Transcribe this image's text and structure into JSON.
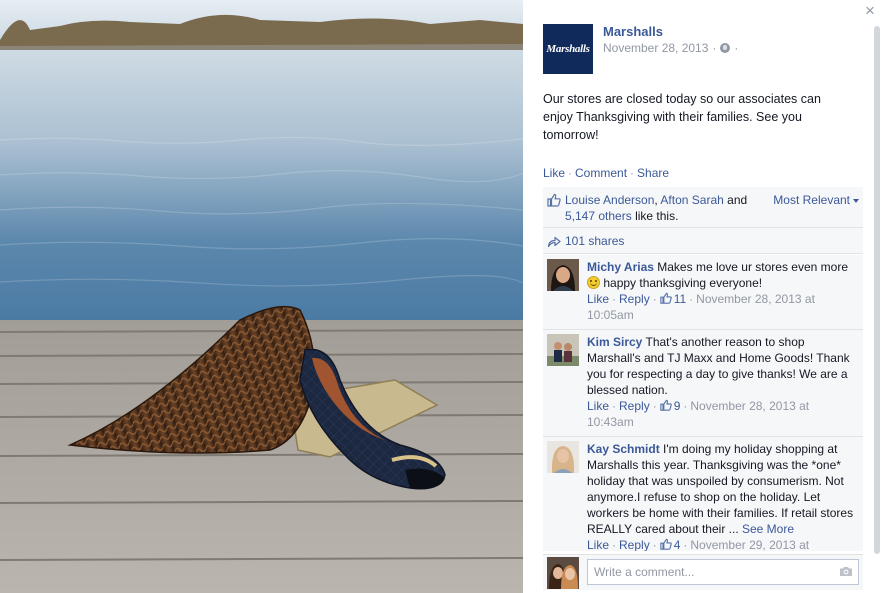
{
  "post": {
    "page_name": "Marshalls",
    "logo_text": "Marshalls",
    "date": "November 28, 2013",
    "privacy_separator": "·",
    "trailing_separator": "·",
    "text": "Our stores are closed today so our associates can enjoy Thanksgiving with their families. See you tomorrow!"
  },
  "actions": {
    "like": "Like",
    "comment": "Comment",
    "share": "Share",
    "separator": "·"
  },
  "likes": {
    "name1": "Louise Anderson",
    "comma": ",",
    "name2": "Afton Sarah",
    "and_word": "and",
    "others": "5,147 others",
    "suffix": "like this.",
    "sort_label": "Most Relevant"
  },
  "shares": {
    "label": "101 shares"
  },
  "comments": [
    {
      "author": "Michy Arias",
      "text_before": "Makes me love ur stores even more",
      "text_after": "happy thanksgiving everyone!",
      "like_label": "Like",
      "reply_label": "Reply",
      "like_count": "11",
      "timestamp": "November 28, 2013 at 10:05am"
    },
    {
      "author": "Kim Sircy",
      "text": "That's another reason to shop Marshall's and TJ Maxx and Home Goods! Thank you for respecting a day to give thanks! We are a blessed nation.",
      "like_label": "Like",
      "reply_label": "Reply",
      "like_count": "9",
      "timestamp": "November 28, 2013 at 10:43am"
    },
    {
      "author": "Kay Schmidt",
      "text": "I'm doing my holiday shopping at Marshalls this year. Thanksgiving was the *one* holiday that was unspoiled by consumerism. Not anymore.I refuse to shop on the holiday. Let workers be home with their families. If retail stores REALLY cared about their ...",
      "see_more": "See More",
      "like_label": "Like",
      "reply_label": "Reply",
      "like_count": "4",
      "timestamp": "November 29, 2013 at"
    }
  ],
  "composer": {
    "placeholder": "Write a comment..."
  },
  "window": {
    "close_glyph": "×"
  },
  "colors": {
    "link": "#3b5998",
    "meta": "#9197a3",
    "ufi_bg": "#f6f7f8",
    "logo_bg": "#0f2a5b"
  }
}
